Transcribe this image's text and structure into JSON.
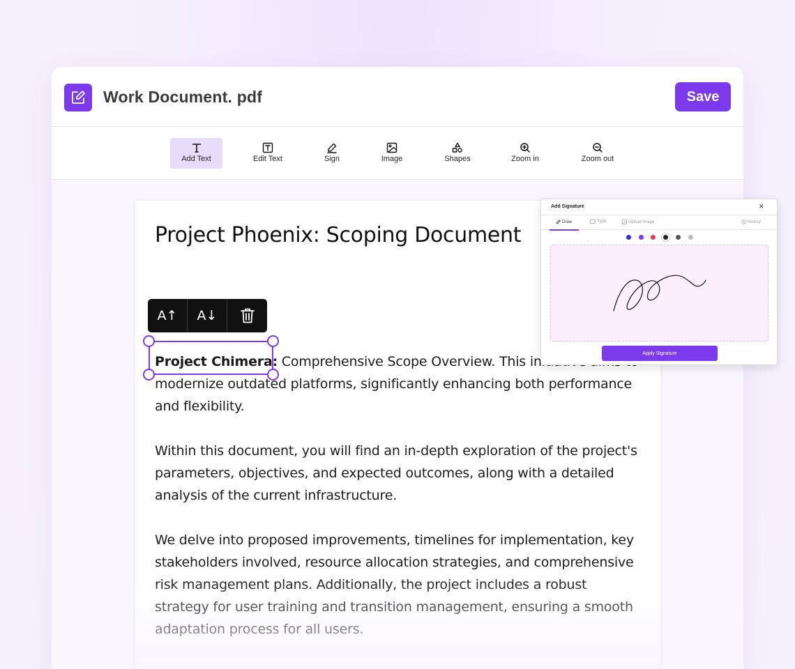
{
  "app": {
    "document_title": "Work Document. pdf",
    "save_label": "Save"
  },
  "toolbar": {
    "tools": [
      {
        "label": "Add Text",
        "icon": "text-icon",
        "active": true
      },
      {
        "label": "Edit Text",
        "icon": "edit-text-icon",
        "active": false
      },
      {
        "label": "Sign",
        "icon": "pen-icon",
        "active": false
      },
      {
        "label": "Image",
        "icon": "image-icon",
        "active": false
      },
      {
        "label": "Shapes",
        "icon": "shapes-icon",
        "active": false
      },
      {
        "label": "Zoom in",
        "icon": "zoom-in-icon",
        "active": false
      },
      {
        "label": "Zoom out",
        "icon": "zoom-out-icon",
        "active": false
      }
    ]
  },
  "document": {
    "heading": "Project Phoenix: Scoping Document",
    "para1_bold": "Project Chimera:",
    "para1_rest": " Comprehensive Scope Overview. This initiative aims to modernize outdated platforms, significantly enhancing both performance and flexibility.",
    "para2": "Within this document, you will find an in-depth exploration of the project's parameters, objectives, and expected outcomes, along with a detailed analysis of the current infrastructure.",
    "para3": "We delve into proposed improvements, timelines for implementation, key stakeholders involved, resource allocation strategies, and comprehensive risk management plans. Additionally, the project includes a robust strategy for user training and transition management, ensuring a smooth adaptation process for all users."
  },
  "text_toolbar": {
    "increase_label": "A↑",
    "decrease_label": "A↓",
    "delete_icon": "trash-icon"
  },
  "signature_panel": {
    "title": "Add Signature",
    "close": "✕",
    "tabs": [
      {
        "label": "Draw",
        "active": true
      },
      {
        "label": "Type",
        "active": false
      },
      {
        "label": "Upload Image",
        "active": false
      }
    ],
    "history_label": "History",
    "colors": [
      "#2b2fd8",
      "#7c3aed",
      "#e0405a",
      "#222222",
      "#555555",
      "#bbbbbb"
    ],
    "selected_color": "#222222",
    "apply_label": "Apply Signature"
  },
  "theme": {
    "accent": "#7c3aed"
  }
}
